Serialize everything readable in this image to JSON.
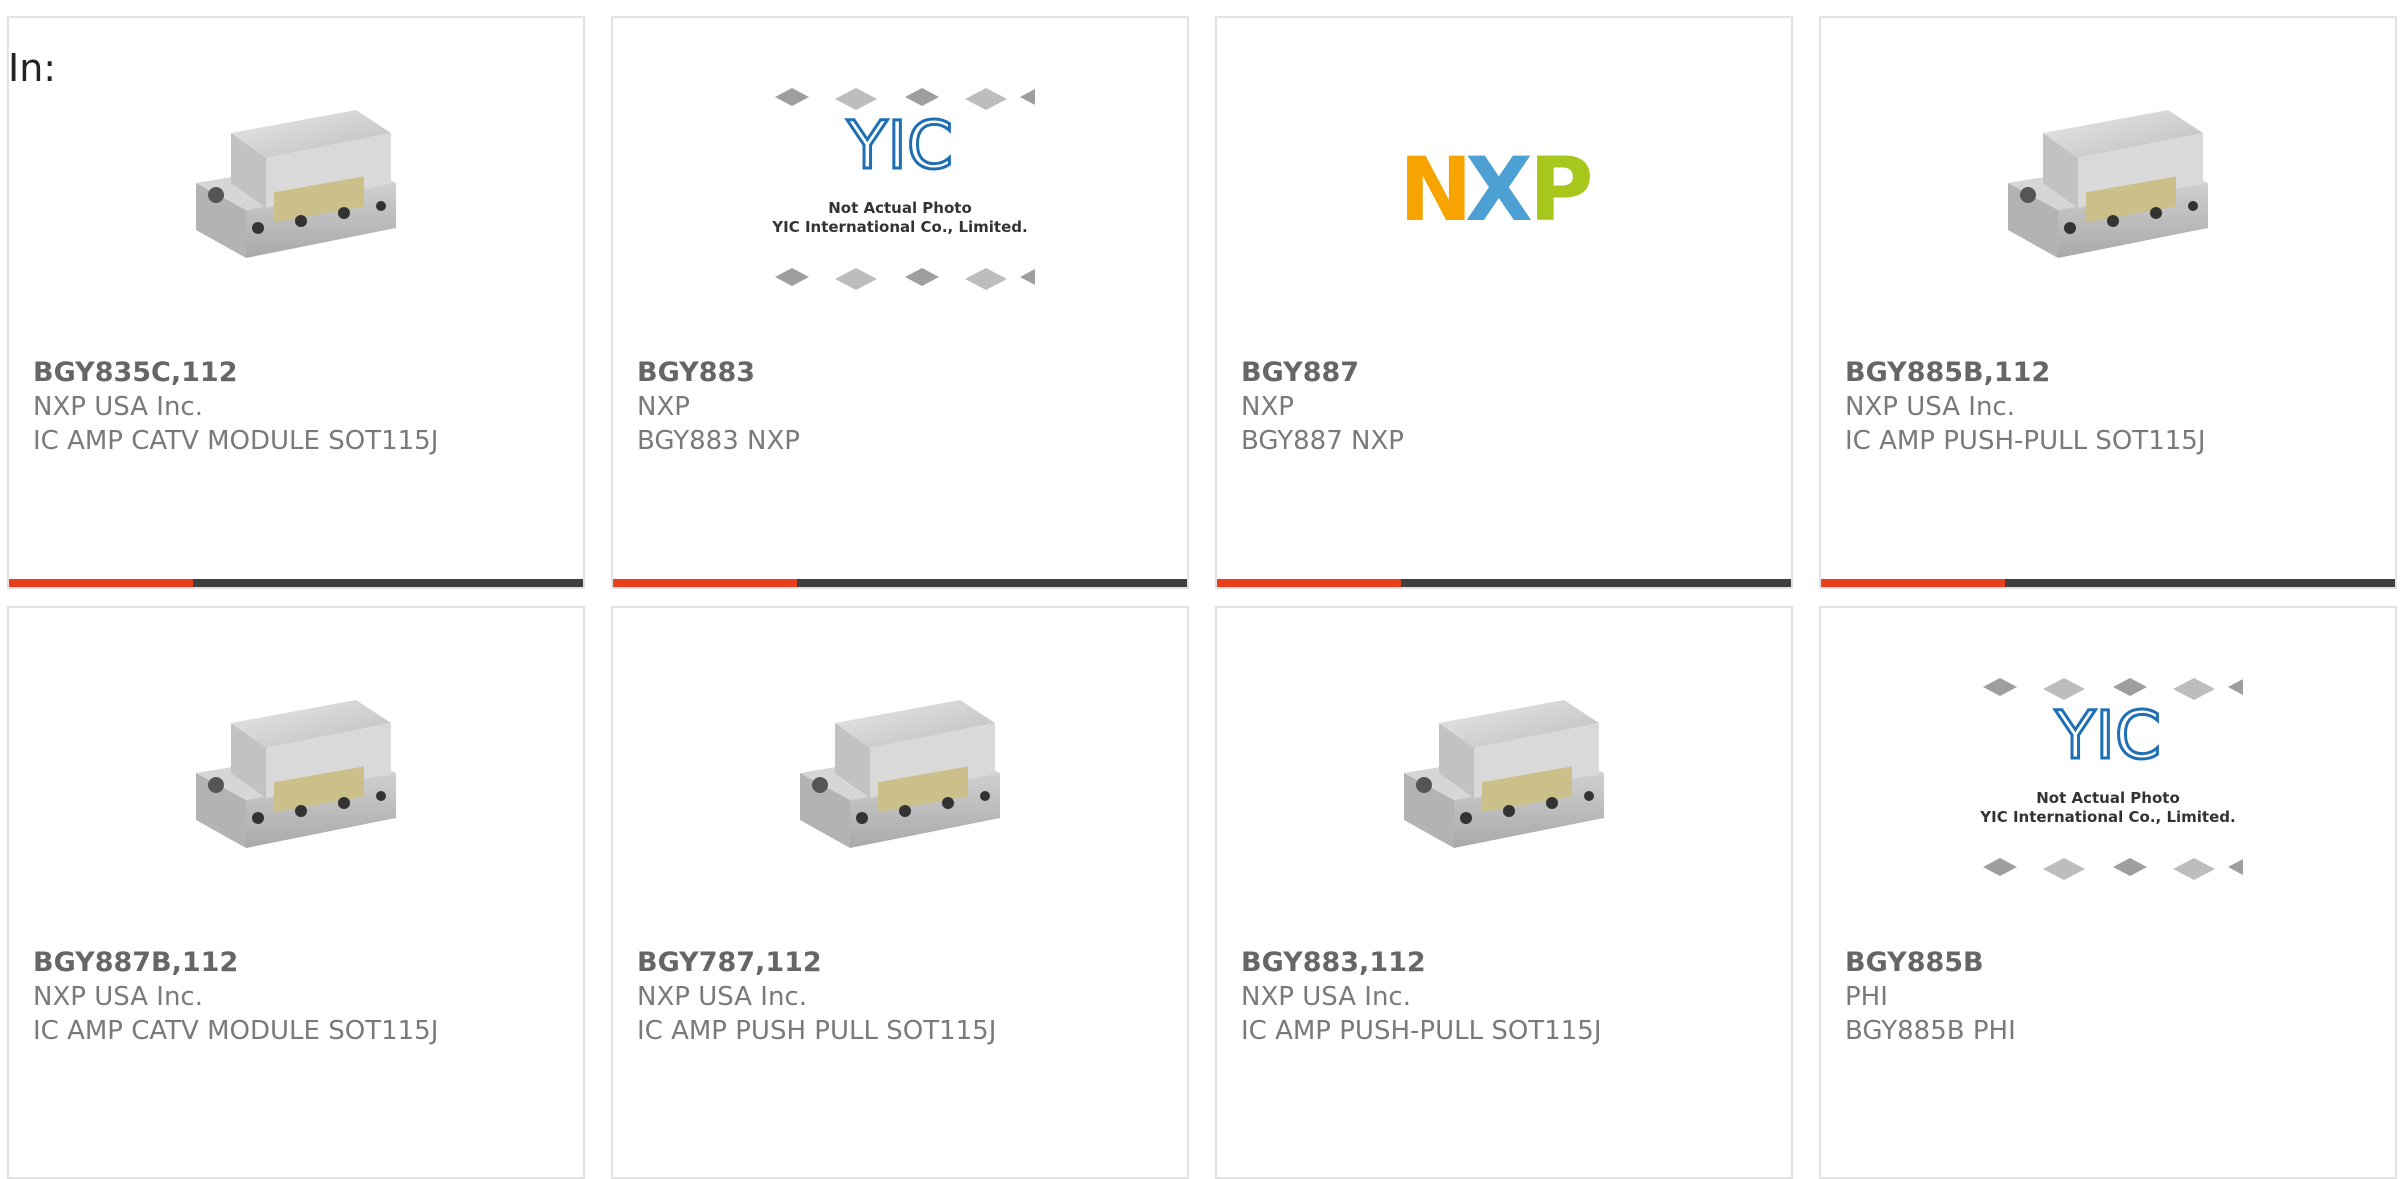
{
  "header": {
    "in_label": "In:"
  },
  "colors": {
    "accent": "#e8401c",
    "bar": "#3f3f3f",
    "nxp_orange": "#f7a400",
    "nxp_blue": "#3a96d0",
    "nxp_green": "#a8c71c",
    "yic_blue": "#1f6fb4"
  },
  "placeholder": {
    "line1": "Not Actual Photo",
    "line2": "YIC International Co., Limited.",
    "logo_text": "YIC"
  },
  "nxp_logo_text": "NXP",
  "products": [
    {
      "part": "BGY835C,112",
      "manufacturer": "NXP USA Inc.",
      "description": "IC AMP CATV MODULE SOT115J",
      "image": "module",
      "progress": 0.32
    },
    {
      "part": "BGY883",
      "manufacturer": "NXP",
      "description": "BGY883 NXP",
      "image": "placeholder",
      "progress": 0.32
    },
    {
      "part": "BGY887",
      "manufacturer": "NXP",
      "description": "BGY887 NXP",
      "image": "nxp-logo",
      "progress": 0.32
    },
    {
      "part": "BGY885B,112",
      "manufacturer": "NXP USA Inc.",
      "description": "IC AMP PUSH-PULL SOT115J",
      "image": "module",
      "progress": 0.32
    },
    {
      "part": "BGY887B,112",
      "manufacturer": "NXP USA Inc.",
      "description": "IC AMP CATV MODULE SOT115J",
      "image": "module"
    },
    {
      "part": "BGY787,112",
      "manufacturer": "NXP USA Inc.",
      "description": "IC AMP PUSH PULL SOT115J",
      "image": "module"
    },
    {
      "part": "BGY883,112",
      "manufacturer": "NXP USA Inc.",
      "description": "IC AMP PUSH-PULL SOT115J",
      "image": "module"
    },
    {
      "part": "BGY885B",
      "manufacturer": "PHI",
      "description": "BGY885B PHI",
      "image": "placeholder"
    }
  ]
}
